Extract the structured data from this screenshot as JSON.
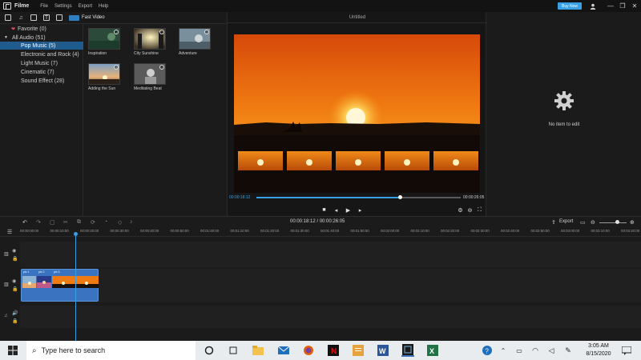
{
  "titlebar": {
    "app_name": "Filme",
    "menu": [
      "File",
      "Settings",
      "Export",
      "Help"
    ],
    "buy_now": "Buy Now"
  },
  "toolbar": {
    "fast_video_label": "Fast Video"
  },
  "categories": [
    {
      "label": "Favorite (0)"
    },
    {
      "label": "All Audio (51)"
    },
    {
      "label": "Pop Music (5)"
    },
    {
      "label": "Electronic and Rock (4)"
    },
    {
      "label": "Light Music (7)"
    },
    {
      "label": "Cinematic (7)"
    },
    {
      "label": "Sound Effect (28)"
    }
  ],
  "media_items": [
    {
      "label": "Inspiration"
    },
    {
      "label": "City Sunshine"
    },
    {
      "label": "Adventure"
    },
    {
      "label": "Adding the Sun"
    },
    {
      "label": "Meditating Beat"
    }
  ],
  "preview": {
    "title": "Untitled",
    "current_time": "00:00:18:12",
    "total_time": "00:00:26:05",
    "progress": 0.7
  },
  "properties": {
    "empty_text": "No item to edit"
  },
  "timeline": {
    "time_display": "00:00:18:12 / 00:00:26:05",
    "export_label": "Export",
    "ruler_ticks": [
      "00:00:00:00",
      "00:00:10:00",
      "00:00:20:00",
      "00:00:30:00",
      "00:00:40:00",
      "00:00:50:00",
      "00:01:00:00",
      "00:01:10:00",
      "00:01:20:00",
      "00:01:30:00",
      "00:01:40:00",
      "00:01:50:00",
      "00:02:00:00",
      "00:02:10:00",
      "00:02:20:00",
      "00:02:30:00",
      "00:02:40:00",
      "00:02:50:00",
      "00:03:00:00",
      "00:03:10:00",
      "00:03:20:00"
    ],
    "clip_labels": [
      "pic 1",
      "pic 2",
      "pic 3"
    ]
  },
  "taskbar": {
    "search_placeholder": "Type here to search",
    "time": "3:05 AM",
    "date": "8/15/2020"
  },
  "colors": {
    "accent": "#3aa0e6",
    "selected_category": "#1f5c8d",
    "clip": "#3a74c0"
  }
}
